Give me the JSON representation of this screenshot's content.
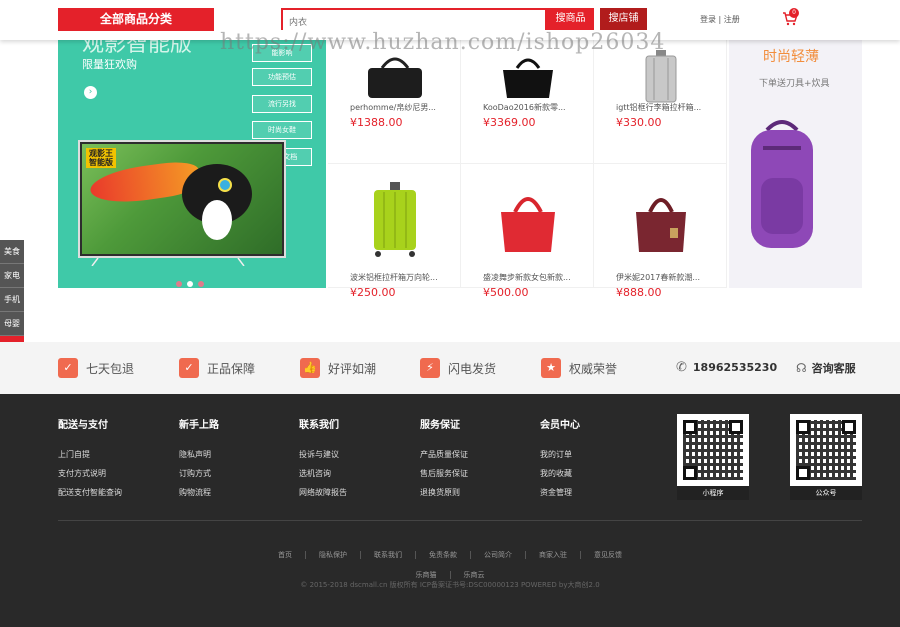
{
  "header": {
    "category_label": "全部商品分类",
    "search_placeholder": "内衣",
    "search_goods": "搜商品",
    "search_shop": "搜店铺",
    "login": "登录 | 注册",
    "cart_count": "0"
  },
  "watermark": "https://www.huzhan.com/ishop26034",
  "banner": {
    "title": "观影智能版",
    "subtitle": "限量狂欢购",
    "tags": [
      "能影响",
      "功能预估",
      "流行另找",
      "时尚女鞋",
      "-运动文档"
    ],
    "tv_label": "观影王\n智能版",
    "color": "#3fc9a8"
  },
  "products": [
    {
      "name": "perhomme/帛纱尼男...",
      "price": "¥1388.00"
    },
    {
      "name": "KooDao2016新款零...",
      "price": "¥3369.00"
    },
    {
      "name": "igtt铝框行李箱拉杆箱...",
      "price": "¥330.00"
    },
    {
      "name": "波米铝框拉杆箱万向轮...",
      "price": "¥250.00"
    },
    {
      "name": "盛凌舞步新款女包新款...",
      "price": "¥500.00"
    },
    {
      "name": "伊米妮2017春新款潮...",
      "price": "¥888.00"
    }
  ],
  "promo": {
    "title": "时尚轻薄",
    "subtitle": "下单送刀具+炊具"
  },
  "sidenav": [
    "美食",
    "家电",
    "手机",
    "母婴",
    "礼包",
    "⊙"
  ],
  "services": [
    {
      "icon": "✓",
      "label": "七天包退"
    },
    {
      "icon": "✓",
      "label": "正品保障"
    },
    {
      "icon": "👍",
      "label": "好评如潮"
    },
    {
      "icon": "⚡",
      "label": "闪电发货"
    },
    {
      "icon": "★",
      "label": "权威荣誉"
    }
  ],
  "phone": "18962535230",
  "service_label": "咨询客服",
  "footer": {
    "columns": [
      {
        "title": "配送与支付",
        "links": [
          "上门自提",
          "支付方式说明",
          "配送支付智能查询"
        ]
      },
      {
        "title": "新手上路",
        "links": [
          "隐私声明",
          "订购方式",
          "购物流程"
        ]
      },
      {
        "title": "联系我们",
        "links": [
          "投诉与建议",
          "选机咨询",
          "网络故障报告"
        ]
      },
      {
        "title": "服务保证",
        "links": [
          "产品质量保证",
          "售后服务保证",
          "退换货原则"
        ]
      },
      {
        "title": "会员中心",
        "links": [
          "我的订单",
          "我的收藏",
          "资金管理"
        ]
      }
    ],
    "qr": [
      "小程序",
      "公众号"
    ],
    "links": [
      "首页",
      "隐私保护",
      "联系我们",
      "免责条款",
      "公司简介",
      "商家入驻",
      "意见反馈"
    ],
    "links2": [
      "乐商猫",
      "乐商云"
    ],
    "copyright": "© 2015-2018 dscmall.cn 版权所有 ICP备案证书号:DSC00000123 POWERED by大商创2.0"
  }
}
